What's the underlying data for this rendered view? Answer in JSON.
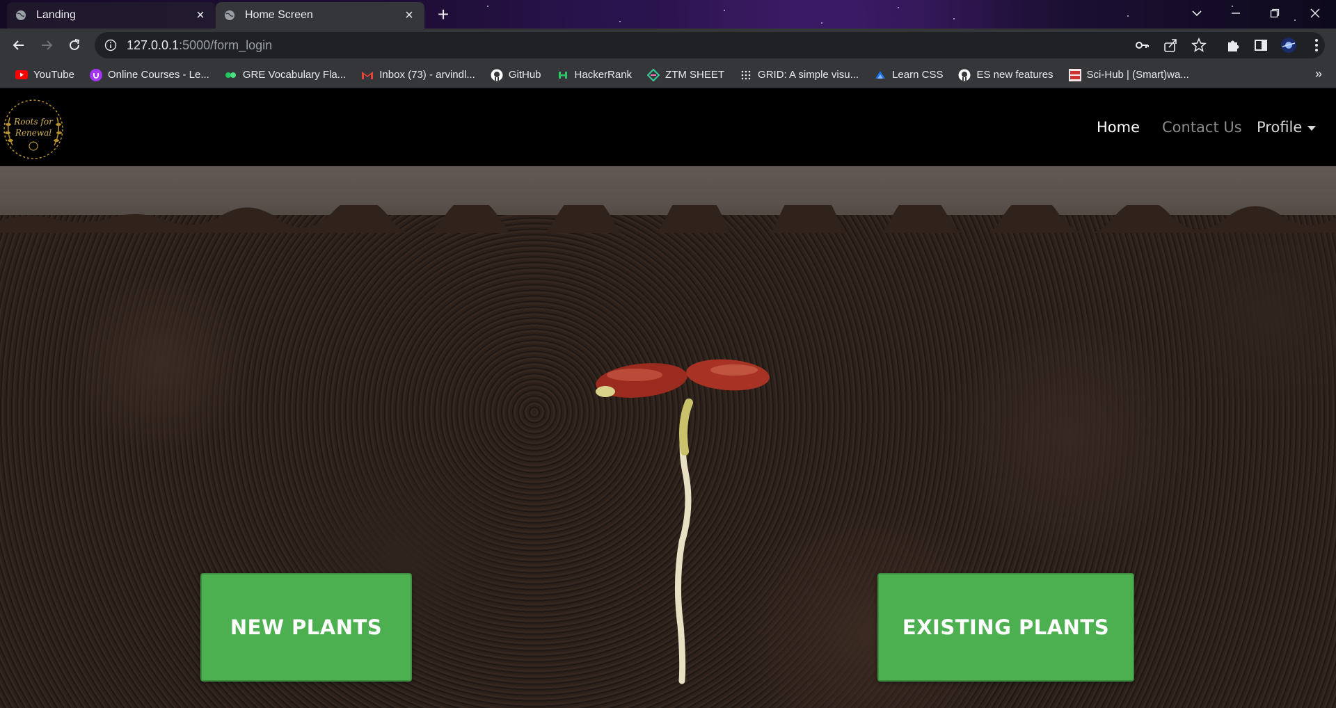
{
  "browser": {
    "tabs": [
      {
        "label": "Landing",
        "active": false
      },
      {
        "label": "Home Screen",
        "active": true
      }
    ],
    "address": {
      "host": "127.0.0.1",
      "path": ":5000/form_login"
    },
    "bookmarks": [
      {
        "label": "YouTube",
        "icon": "youtube-icon",
        "color": "#ff0000"
      },
      {
        "label": "Online Courses - Le...",
        "icon": "udemy-icon",
        "color": "#a435f0"
      },
      {
        "label": "GRE Vocabulary Fla...",
        "icon": "flashcard-icon",
        "color": "#22c55e"
      },
      {
        "label": "Inbox (73) - arvindl...",
        "icon": "gmail-icon",
        "color": "#ea4335"
      },
      {
        "label": "GitHub",
        "icon": "github-icon",
        "color": "#ffffff"
      },
      {
        "label": "HackerRank",
        "icon": "hackerrank-icon",
        "color": "#2ec866"
      },
      {
        "label": "ZTM SHEET",
        "icon": "ztm-icon",
        "color": "#34d399"
      },
      {
        "label": "GRID: A simple visu...",
        "icon": "grid-icon",
        "color": "#e8eaed"
      },
      {
        "label": "Learn CSS",
        "icon": "learn-css-icon",
        "color": "#1a73e8"
      },
      {
        "label": "ES new features",
        "icon": "github-icon",
        "color": "#ffffff"
      },
      {
        "label": "Sci-Hub | (Smart)wa...",
        "icon": "scihub-icon",
        "color": "#cc3333"
      }
    ],
    "bookmarks_more": "»"
  },
  "site": {
    "logo_text_line1": "Roots for",
    "logo_text_line2": "Renewal",
    "nav": {
      "home": "Home",
      "contact": "Contact Us",
      "profile": "Profile"
    },
    "buttons": {
      "new_plants": "NEW PLANTS",
      "existing_plants": "EXISTING PLANTS"
    },
    "accent_color": "#4caf50"
  }
}
